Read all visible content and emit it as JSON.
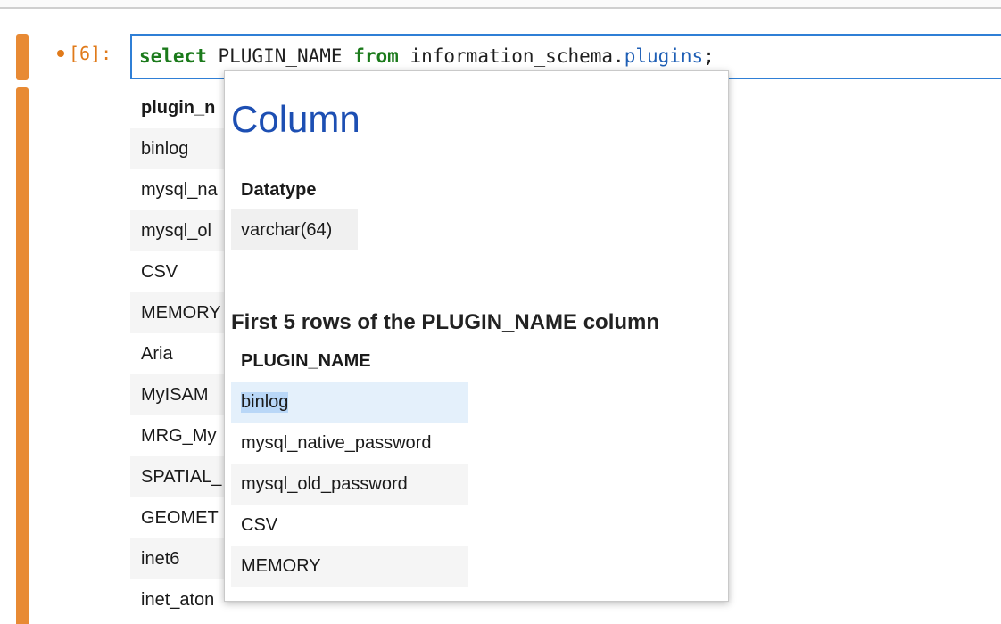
{
  "cell": {
    "prompt": "[6]:",
    "code": {
      "kw_select": "select",
      "column": " PLUGIN_NAME ",
      "kw_from": "from",
      "schema": " information_schema.",
      "table": "plugins",
      "end": ";"
    }
  },
  "output": {
    "header": "plugin_n",
    "rows": [
      "binlog",
      "mysql_na",
      "mysql_ol",
      "CSV",
      "MEMORY",
      "Aria",
      "MyISAM",
      "MRG_My",
      "SPATIAL_",
      "GEOMET",
      "inet6",
      "inet_aton"
    ]
  },
  "popup": {
    "title": "Column",
    "datatype_label": "Datatype",
    "datatype_value": "varchar(64)",
    "preview_title": "First 5 rows of the PLUGIN_NAME column",
    "preview_header": "PLUGIN_NAME",
    "preview_rows": [
      "binlog",
      "mysql_native_password",
      "mysql_old_password",
      "CSV",
      "MEMORY"
    ]
  }
}
